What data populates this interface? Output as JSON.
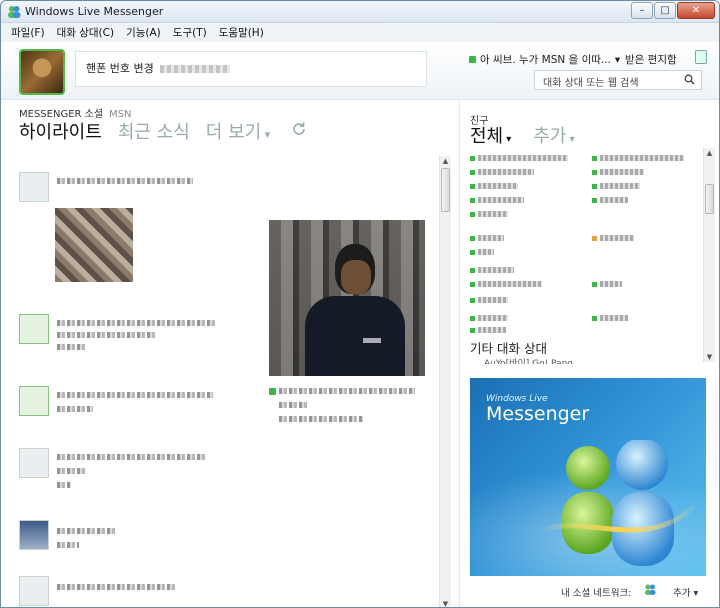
{
  "window": {
    "title": "Windows Live Messenger",
    "min_glyph": "–",
    "max_glyph": "□",
    "close_glyph": "✕"
  },
  "menu": [
    "파일(F)",
    "대화 상대(C)",
    "기능(A)",
    "도구(T)",
    "도움말(H)"
  ],
  "profile": {
    "status_message": "핸폰 번호 변경",
    "now_playing": "아 씨브. 누가 MSN 을 이따...",
    "inbox": "받은 편지함",
    "search_placeholder": "대화 상대 또는 웹 검색"
  },
  "social": {
    "source": "MESSENGER 소셜",
    "network": "MSN",
    "tabs": {
      "highlights": "하이라이트",
      "recent": "최근 소식",
      "more": "더 보기"
    }
  },
  "contacts": {
    "heading": "친구",
    "tab_all": "전체",
    "tab_add": "추가",
    "other_group": "기타 대화 상대",
    "other_group_sub": "AuYo[바이] Go! Pang"
  },
  "ad": {
    "brand": "Windows Live",
    "product": "Messenger"
  },
  "footer": {
    "social_network_label": "내 소셜 네트워크:",
    "add_label": "추가"
  },
  "colors": {
    "online": "#39b54a",
    "away": "#e8a23a",
    "accent": "#2f93d6"
  },
  "icons": {
    "app": "messenger-buddies-icon",
    "search": "search-icon",
    "refresh": "refresh-icon",
    "inbox": "inbox-icon"
  }
}
